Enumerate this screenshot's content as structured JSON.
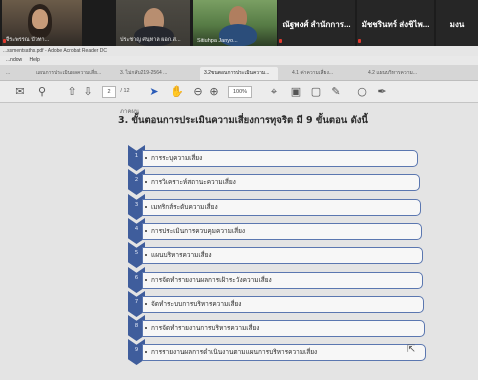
{
  "video_call": {
    "participants": [
      {
        "caption": "จีระพรรณ บัวทา..."
      },
      {
        "caption": "ประชาญ ศนฺทาล ผอก.ส..."
      },
      {
        "caption": "Sitiuhpa Janyo..."
      },
      {
        "caption": "ณัฐพงศ์ สำนักการ..."
      },
      {
        "caption": "มัชชรินทร์ ส่งชิไพ..."
      },
      {
        "caption": "มงน"
      }
    ]
  },
  "acrobat": {
    "window_title": "...ssmentsaths.pdf - Adobe Acrobat Reader DC",
    "menu": [
      "...ndow",
      "Help"
    ],
    "tabs": [
      {
        "label": "...",
        "active": false
      },
      {
        "label": "แผนการประเมินผลความเสี่ย...",
        "active": false
      },
      {
        "label": "3. ไม่กลับ219-2564 ...",
        "active": false
      },
      {
        "label": "3.2ขนตอนการประเมินความ...",
        "active": true
      },
      {
        "label": "4.1 ค่าความเสี่ยง...",
        "active": false
      },
      {
        "label": "4.2 แผนบริหารความ...",
        "active": false
      }
    ],
    "toolbar": {
      "page_current": "2",
      "page_total": "/ 12",
      "zoom": "100%"
    }
  },
  "document": {
    "label": "ภาคผนู",
    "heading": "3. ขั้นตอนการประเมินความเสี่ยงการทุจริต มี 9 ขั้นตอน ดังนี้",
    "steps": [
      {
        "num": "1",
        "text": "การระบุความเสี่ยง"
      },
      {
        "num": "2",
        "text": "การวิเคราะห์สถานะความเสี่ยง"
      },
      {
        "num": "3",
        "text": "เมทริกส์ระดับความเสี่ยง"
      },
      {
        "num": "4",
        "text": "การประเมินการควบคุมความเสี่ยง"
      },
      {
        "num": "5",
        "text": "แผนบริหารความเสี่ยง"
      },
      {
        "num": "6",
        "text": "การจัดทำรายงานผลการเฝ้าระวังความเสี่ยง"
      },
      {
        "num": "7",
        "text": "จัดทำระบบการบริหารความเสี่ยง"
      },
      {
        "num": "8",
        "text": "การจัดทำรายงานการบริหารความเสี่ยง"
      },
      {
        "num": "9",
        "text": "การรายงานผลการดำเนินงานตามแผนการบริหารความเสี่ยง"
      }
    ]
  },
  "colors": {
    "chevron": "#3f5d9c",
    "step_border": "#5b77b0"
  }
}
